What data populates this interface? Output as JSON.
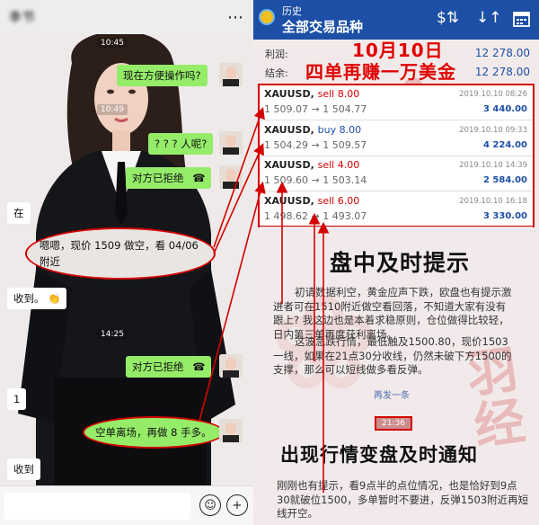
{
  "chat": {
    "title": "季节",
    "more_icon": "more-icon",
    "times": [
      "10:45",
      "10:49",
      "14:25"
    ],
    "messages": [
      {
        "side": "right",
        "text": "现在方便操作吗?"
      },
      {
        "side": "right",
        "text": "? ? ? 人呢?"
      },
      {
        "side": "right",
        "text": "对方已拒绝",
        "icon": "phone-hangup-icon"
      },
      {
        "side": "left",
        "text": "在"
      },
      {
        "side": "left",
        "text": "嗯嗯，现价 1509 做空，看 04/06 附近"
      },
      {
        "side": "left",
        "text": "收到。",
        "icon": "clap-emoji-icon"
      },
      {
        "side": "right",
        "text": "对方已拒绝",
        "icon": "phone-hangup-icon"
      },
      {
        "side": "left",
        "text": "1"
      },
      {
        "side": "right",
        "text": "空单离场，再做 8 手多。"
      },
      {
        "side": "left",
        "text": "收到"
      }
    ],
    "input": {
      "emoji_icon": "emoji-icon",
      "plus_icon": "plus-icon"
    }
  },
  "app": {
    "subtitle": "历史",
    "title": "全部交易品种",
    "toolbar_icons": [
      "dollar-exchange-icon",
      "sort-icon",
      "calendar-icon"
    ],
    "summary": {
      "profit_label": "利润:",
      "profit_value": "12 278.00",
      "balance_label": "结余:",
      "balance_value": "12 278.00"
    },
    "headline_top": "10月10日",
    "headline_main": "四单再赚一万美金",
    "trades": [
      {
        "symbol": "XAUUSD,",
        "side": "sell 8.00",
        "side_color": "#d40000",
        "open": "1 509.07",
        "close": "1 504.77",
        "date": "2019.10.10 08:26",
        "profit": "3 440.00"
      },
      {
        "symbol": "XAUUSD,",
        "side": "buy 8.00",
        "side_color": "#1c4fa5",
        "open": "1 504.29",
        "close": "1 509.57",
        "date": "2019.10.10 09:33",
        "profit": "4 224.00"
      },
      {
        "symbol": "XAUUSD,",
        "side": "sell 4.00",
        "side_color": "#d40000",
        "open": "1 509.60",
        "close": "1 503.14",
        "date": "2019.10.10 14:39",
        "profit": "2 584.00"
      },
      {
        "symbol": "XAUUSD,",
        "side": "sell 6.00",
        "side_color": "#d40000",
        "open": "1 498.62",
        "close": "1 493.07",
        "date": "2019.10.10 16:18",
        "profit": "3 330.00"
      }
    ],
    "arrow": "→",
    "headline_mid": "盘中及时提示",
    "para1a": "初请数据利空，黄金应声下跌，欧盘也有提示激进者可在1510附近做空看回落，不知道大家有没有跟上? 我这边也是本着求稳原则，仓位做得比较轻，日内第三单再度获利离场。",
    "para1b": "这波急跌行情，最低触及1500.80，现价1503一线，如果在21点30分收线，仍然未破下方1500的支撑，那么可以短线做多看反弹。",
    "reply_link": "再发一条",
    "timestamp_box": "21:36",
    "headline_bottom": "出现行情变盘及时通知",
    "para2": "刚刚也有提示，看9点半的点位情况，也是恰好到9点30就破位1500，多单暂时不要进，反弹1503附近再短线开空。",
    "watermark": "羽经"
  },
  "colors": {
    "accent_red": "#d40000",
    "app_blue": "#1c4fa5",
    "bubble_green": "#95ec69"
  }
}
